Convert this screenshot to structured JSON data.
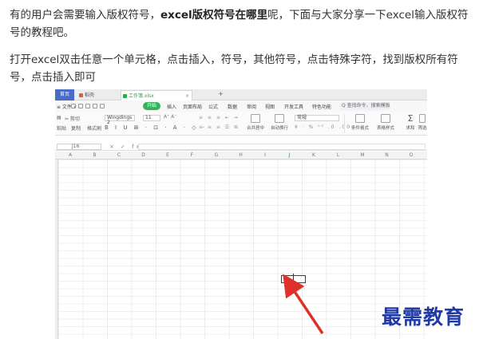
{
  "article": {
    "p1_before": "有的用户会需要输入版权符号，",
    "p1_bold": "excel版权符号在哪里",
    "p1_after": "呢，下面与大家分享一下excel输入版权符号的教程吧。",
    "p2": "打开excel双击任意一个单元格，点击插入，符号，其他符号，点击特殊字符，找到版权所有符号，点击插入即可"
  },
  "screenshot": {
    "tabs": {
      "home": "首页",
      "wps": "稻壳",
      "workbook": "工作簿.xlsx",
      "close": "×",
      "add": "+"
    },
    "menu": {
      "file": "≡ 文件 ∨",
      "start": "开始",
      "items": [
        "插入",
        "页面布局",
        "公式",
        "数据",
        "审阅",
        "视图",
        "开发工具",
        "特色功能"
      ],
      "search": "Q 查找命令、搜索模板"
    },
    "ribbon": {
      "cut": "✂ 剪切",
      "paste": "粘贴",
      "copy": "复制",
      "format_painter": "格式刷",
      "font_name": "Wingdings 2",
      "font_size": "11",
      "bold_row": "B I U ⊞ · ⊡ · A · ◇ ·",
      "merge": "合并居中",
      "wrap": "自动换行",
      "number_format": "常规",
      "cond_format": "条件格式",
      "cell_style": "表格样式",
      "sum": "求和",
      "filter": "筛选"
    },
    "formula_bar": {
      "name_box": "J16",
      "icons": "× ✓ fx",
      "value": ""
    },
    "columns": [
      "A",
      "B",
      "C",
      "D",
      "E",
      "F",
      "G",
      "H",
      "I",
      "J",
      "K",
      "L",
      "M",
      "N",
      "O"
    ],
    "selected_column": "J"
  },
  "watermark": "最需教育",
  "colors": {
    "accent_green": "#30b35a",
    "watermark_blue": "#1f3aa8",
    "arrow_red": "#e0302a"
  }
}
